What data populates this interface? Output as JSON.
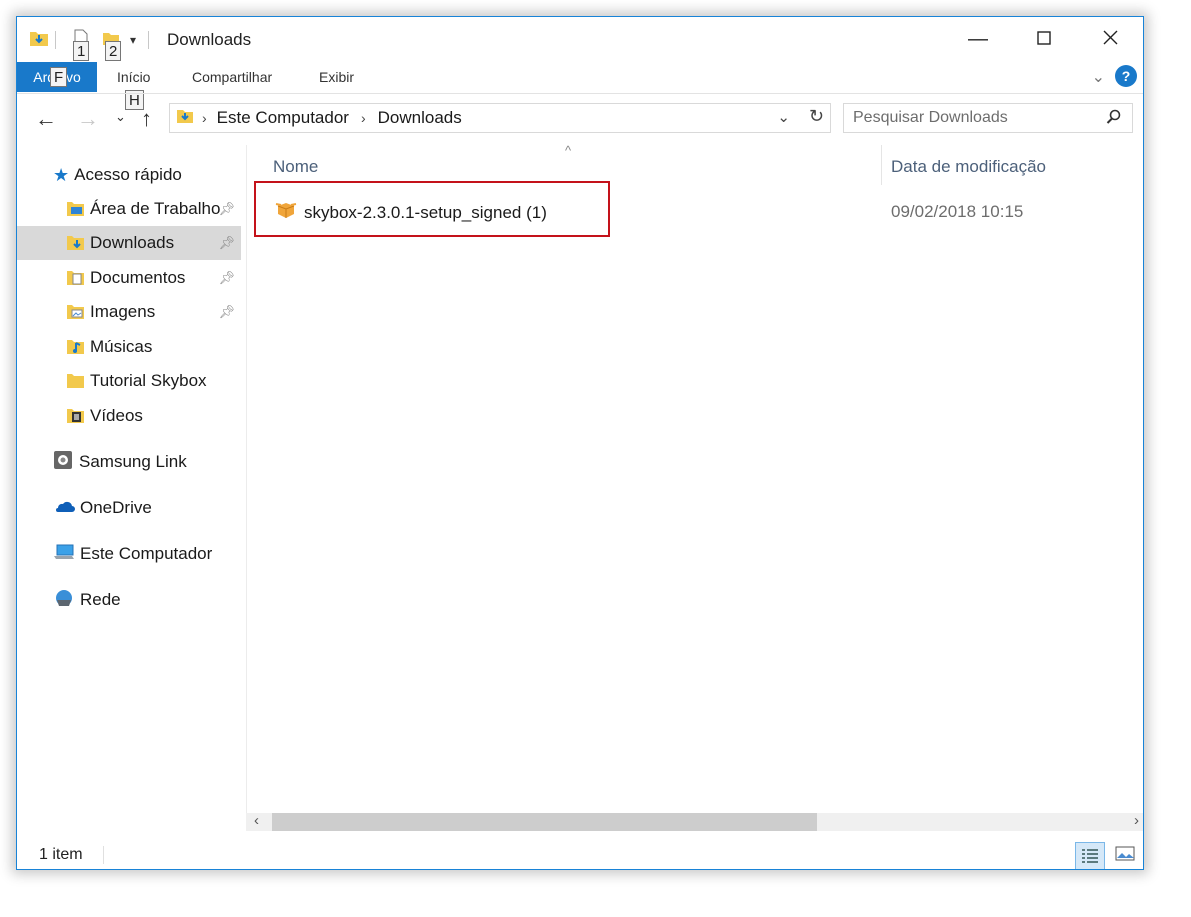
{
  "window": {
    "title": "Downloads"
  },
  "keytips": {
    "qat1": "1",
    "qat2": "2",
    "file": "F",
    "home": "H"
  },
  "ribbon": {
    "file_tab": "Arquivo",
    "tabs": [
      "Início",
      "Compartilhar",
      "Exibir"
    ],
    "help": "?"
  },
  "address": {
    "crumbs": [
      "Este Computador",
      "Downloads"
    ],
    "search_placeholder": "Pesquisar Downloads"
  },
  "sidebar": {
    "quick_access": "Acesso rápido",
    "items": [
      {
        "label": "Área de Trabalho",
        "icon": "desktop-folder-icon",
        "pinned": true
      },
      {
        "label": "Downloads",
        "icon": "downloads-folder-icon",
        "pinned": true,
        "selected": true
      },
      {
        "label": "Documentos",
        "icon": "documents-folder-icon",
        "pinned": true
      },
      {
        "label": "Imagens",
        "icon": "pictures-folder-icon",
        "pinned": true
      },
      {
        "label": "Músicas",
        "icon": "music-folder-icon",
        "pinned": false
      },
      {
        "label": "Tutorial Skybox",
        "icon": "folder-icon",
        "pinned": false
      },
      {
        "label": "Vídeos",
        "icon": "videos-folder-icon",
        "pinned": false
      }
    ],
    "locations": [
      {
        "label": "Samsung Link",
        "icon": "samsung-link-icon"
      },
      {
        "label": "OneDrive",
        "icon": "onedrive-cloud-icon"
      },
      {
        "label": "Este Computador",
        "icon": "computer-icon"
      },
      {
        "label": "Rede",
        "icon": "network-icon"
      }
    ]
  },
  "columns": {
    "name": "Nome",
    "date": "Data de modificação"
  },
  "files": [
    {
      "name": "skybox-2.3.0.1-setup_signed (1)",
      "date": "09/02/2018 10:15",
      "icon": "installer-package-icon"
    }
  ],
  "status": {
    "count": "1 item"
  },
  "colors": {
    "accent": "#1979ca",
    "highlight": "#c4121a",
    "selected": "#d9d9d9"
  }
}
